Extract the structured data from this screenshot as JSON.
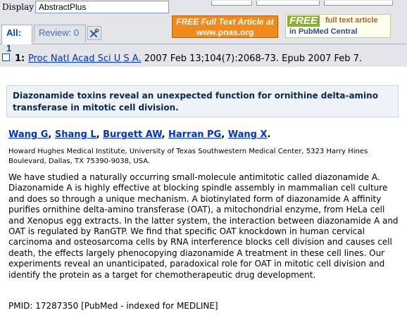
{
  "toolbar": {
    "display_label": "Display",
    "display_value": "AbstractPlus"
  },
  "tabs": {
    "all_label": "All: 1",
    "review_label": "Review: 0"
  },
  "banners": {
    "pnas_line1": "FREE Full Text Article at",
    "pnas_line2": "www.pnas.org",
    "pmc_free": "FREE",
    "pmc_line1": "full text article",
    "pmc_line2": "in PubMed Central"
  },
  "citation": {
    "number": "1:",
    "journal": "Proc Natl Acad Sci U S A.",
    "details": " 2007 Feb 13;104(7):2068-73. Epub 2007 Feb 7."
  },
  "article": {
    "title": "Diazonamide toxins reveal an unexpected function for ornithine delta-amino transferase in mitotic cell division.",
    "authors": [
      "Wang G",
      "Shang L",
      "Burgett AW",
      "Harran PG",
      "Wang X"
    ],
    "affiliation": "Howard Hughes Medical Institute, University of Texas Southwestern Medical Center, 5323 Harry Hines Boulevard, Dallas, TX 75390-9038, USA.",
    "abstract": "We have studied a naturally occurring small-molecule antimitotic called diazonamide A. Diazonamide A is highly effective at blocking spindle assembly in mammalian cell culture and does so through a unique mechanism. A biotinylated form of diazonamide A affinity purifies ornithine delta-amino transferase (OAT), a mitochondrial enzyme, from HeLa cell and Xenopus egg extracts. In the latter system, the interaction between diazonamide A and OAT is regulated by RanGTP. We find that specific OAT knockdown in human cervical carcinoma and osteosarcoma cells by RNA interference blocks cell division and causes cell death, the effects largely phenocopying diazonamide A treatment in these cell lines. Our experiments reveal an unanticipated, paradoxical role for OAT in mitotic cell division and identify the protein as a target for chemotherapeutic drug development.",
    "pmid": "PMID: 17287350 [PubMed - indexed for MEDLINE]"
  },
  "colors": {
    "link": "#0033cc",
    "toolbar_bg": "#e3e5e8",
    "title_bg": "#eef3f9"
  }
}
